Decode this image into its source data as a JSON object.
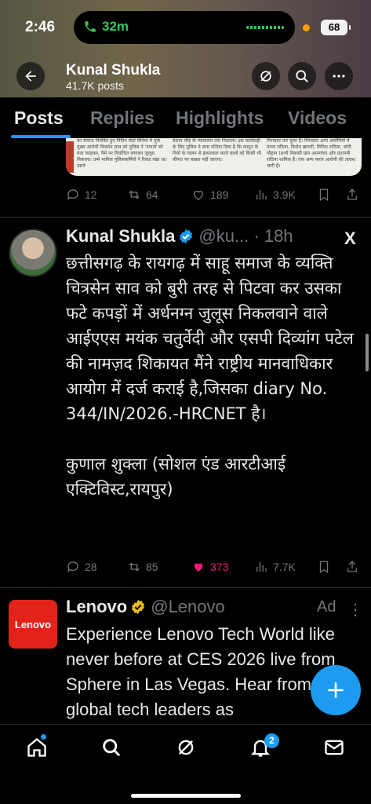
{
  "status_bar": {
    "time": "2:46",
    "call_duration": "32m",
    "battery": "68"
  },
  "profile_header": {
    "name": "Kunal Shukla",
    "posts_count": "41.7K posts"
  },
  "tabs": [
    "Posts",
    "Replies",
    "Highlights",
    "Videos"
  ],
  "prev_post": {
    "newspaper_cols": [
      "का समाज नियंत्रित हुए नितिन सेठों सिनेमा मे पुके मुख्य आरोपी चित्रसेन साव को पुलिस ने 'नग्नतों को मता फाड़कर, पैसे पर निर्वाचित लगाकर जुलूस निकाला। उम्मे मामिल पुलिसकर्मियों ने रिकड रखा था। उसने",
      "प्रेशान भीड़ के न्यायालय तक निकाला। इस कार्यवाही के लिए पुलिस ने स्पष्ट नज़िया दिया है कि कानून के नियों के पालन से इंकारकार करने वालो को किसी भी कीमत पर बख्शा नहीं जाएगा।",
      "गिरफ्तार कर चुका है। गिरफ्तार अन्य आरोपियों में मंगल राठिया, विनोद खम्परी, मिनिश राठिया, कोरी चौहान (सभी निवासी ग्राम आमगांव) और प्रतापनी राठिया शामिल हैं। एक अन्य फरार आरोपी की तलाश जारी है।"
    ],
    "replies": "12",
    "reposts": "64",
    "likes": "189",
    "views": "3.9K"
  },
  "post": {
    "author": "Kunal Shukla",
    "handle": "@ku...",
    "time": "· 18h",
    "brand_mark": "X",
    "body": "छत्तीसगढ़ के रायगढ़ में साहू समाज के व्यक्ति चित्रसेन साव को बुरी तरह से पिटवा कर उसका फटे कपड़ों में अर्धनग्न जुलूस निकलवाने वाले आईएएस मयंक चतुर्वेदी और एसपी दिव्यांग पटेल की नामज़द शिकायत मैंने राष्ट्रीय मानवाधिकार आयोग में दर्ज कराई है,जिसका diary No. 344/IN/2026.-HRCNET है।\n\nकुणाल शुक्ला (सोशल एंड आरटीआई एक्टिविस्ट,रायपुर)",
    "replies": "28",
    "reposts": "85",
    "likes": "373",
    "views": "7.7K"
  },
  "ad": {
    "logo_text": "Lenovo",
    "author": "Lenovo",
    "handle": "@Lenovo",
    "tag": "Ad",
    "body": "Experience Lenovo Tech World like never before at CES 2026 live from Sphere in Las Vegas. Hear from global tech leaders as"
  },
  "bottom_nav": {
    "notifications_badge": "2"
  },
  "colors": {
    "accent": "#1d9bf0",
    "like_pink": "#f91880",
    "muted": "#71767b",
    "lenovo_red": "#e2231a"
  }
}
